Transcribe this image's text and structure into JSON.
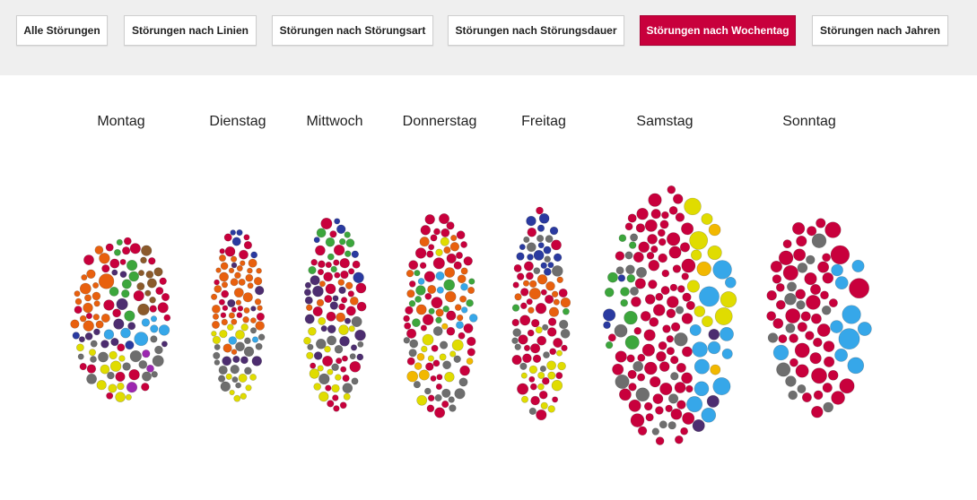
{
  "nav": {
    "tabs": [
      {
        "label": "Alle Störungen",
        "active": false
      },
      {
        "label": "Störungen nach Linien",
        "active": false
      },
      {
        "label": "Störungen nach Störungsart",
        "active": false
      },
      {
        "label": "Störungen nach Störungsdauer",
        "active": false
      },
      {
        "label": "Störungen nach Wochentag",
        "active": true
      },
      {
        "label": "Störungen nach Jahren",
        "active": false
      }
    ]
  },
  "days": [
    {
      "label": "Montag"
    },
    {
      "label": "Dienstag"
    },
    {
      "label": "Mittwoch"
    },
    {
      "label": "Donnerstag"
    },
    {
      "label": "Freitag"
    },
    {
      "label": "Samstag"
    },
    {
      "label": "Sonntag"
    }
  ],
  "colors": {
    "accent": "#c8003c",
    "bubble_palette": [
      "#c8003c",
      "#e8600e",
      "#2a3aa0",
      "#4d2d70",
      "#3ca63c",
      "#e0dc00",
      "#36a7e9",
      "#6e6e6e",
      "#f2b800",
      "#8b5a2b",
      "#9c27b0"
    ]
  }
}
